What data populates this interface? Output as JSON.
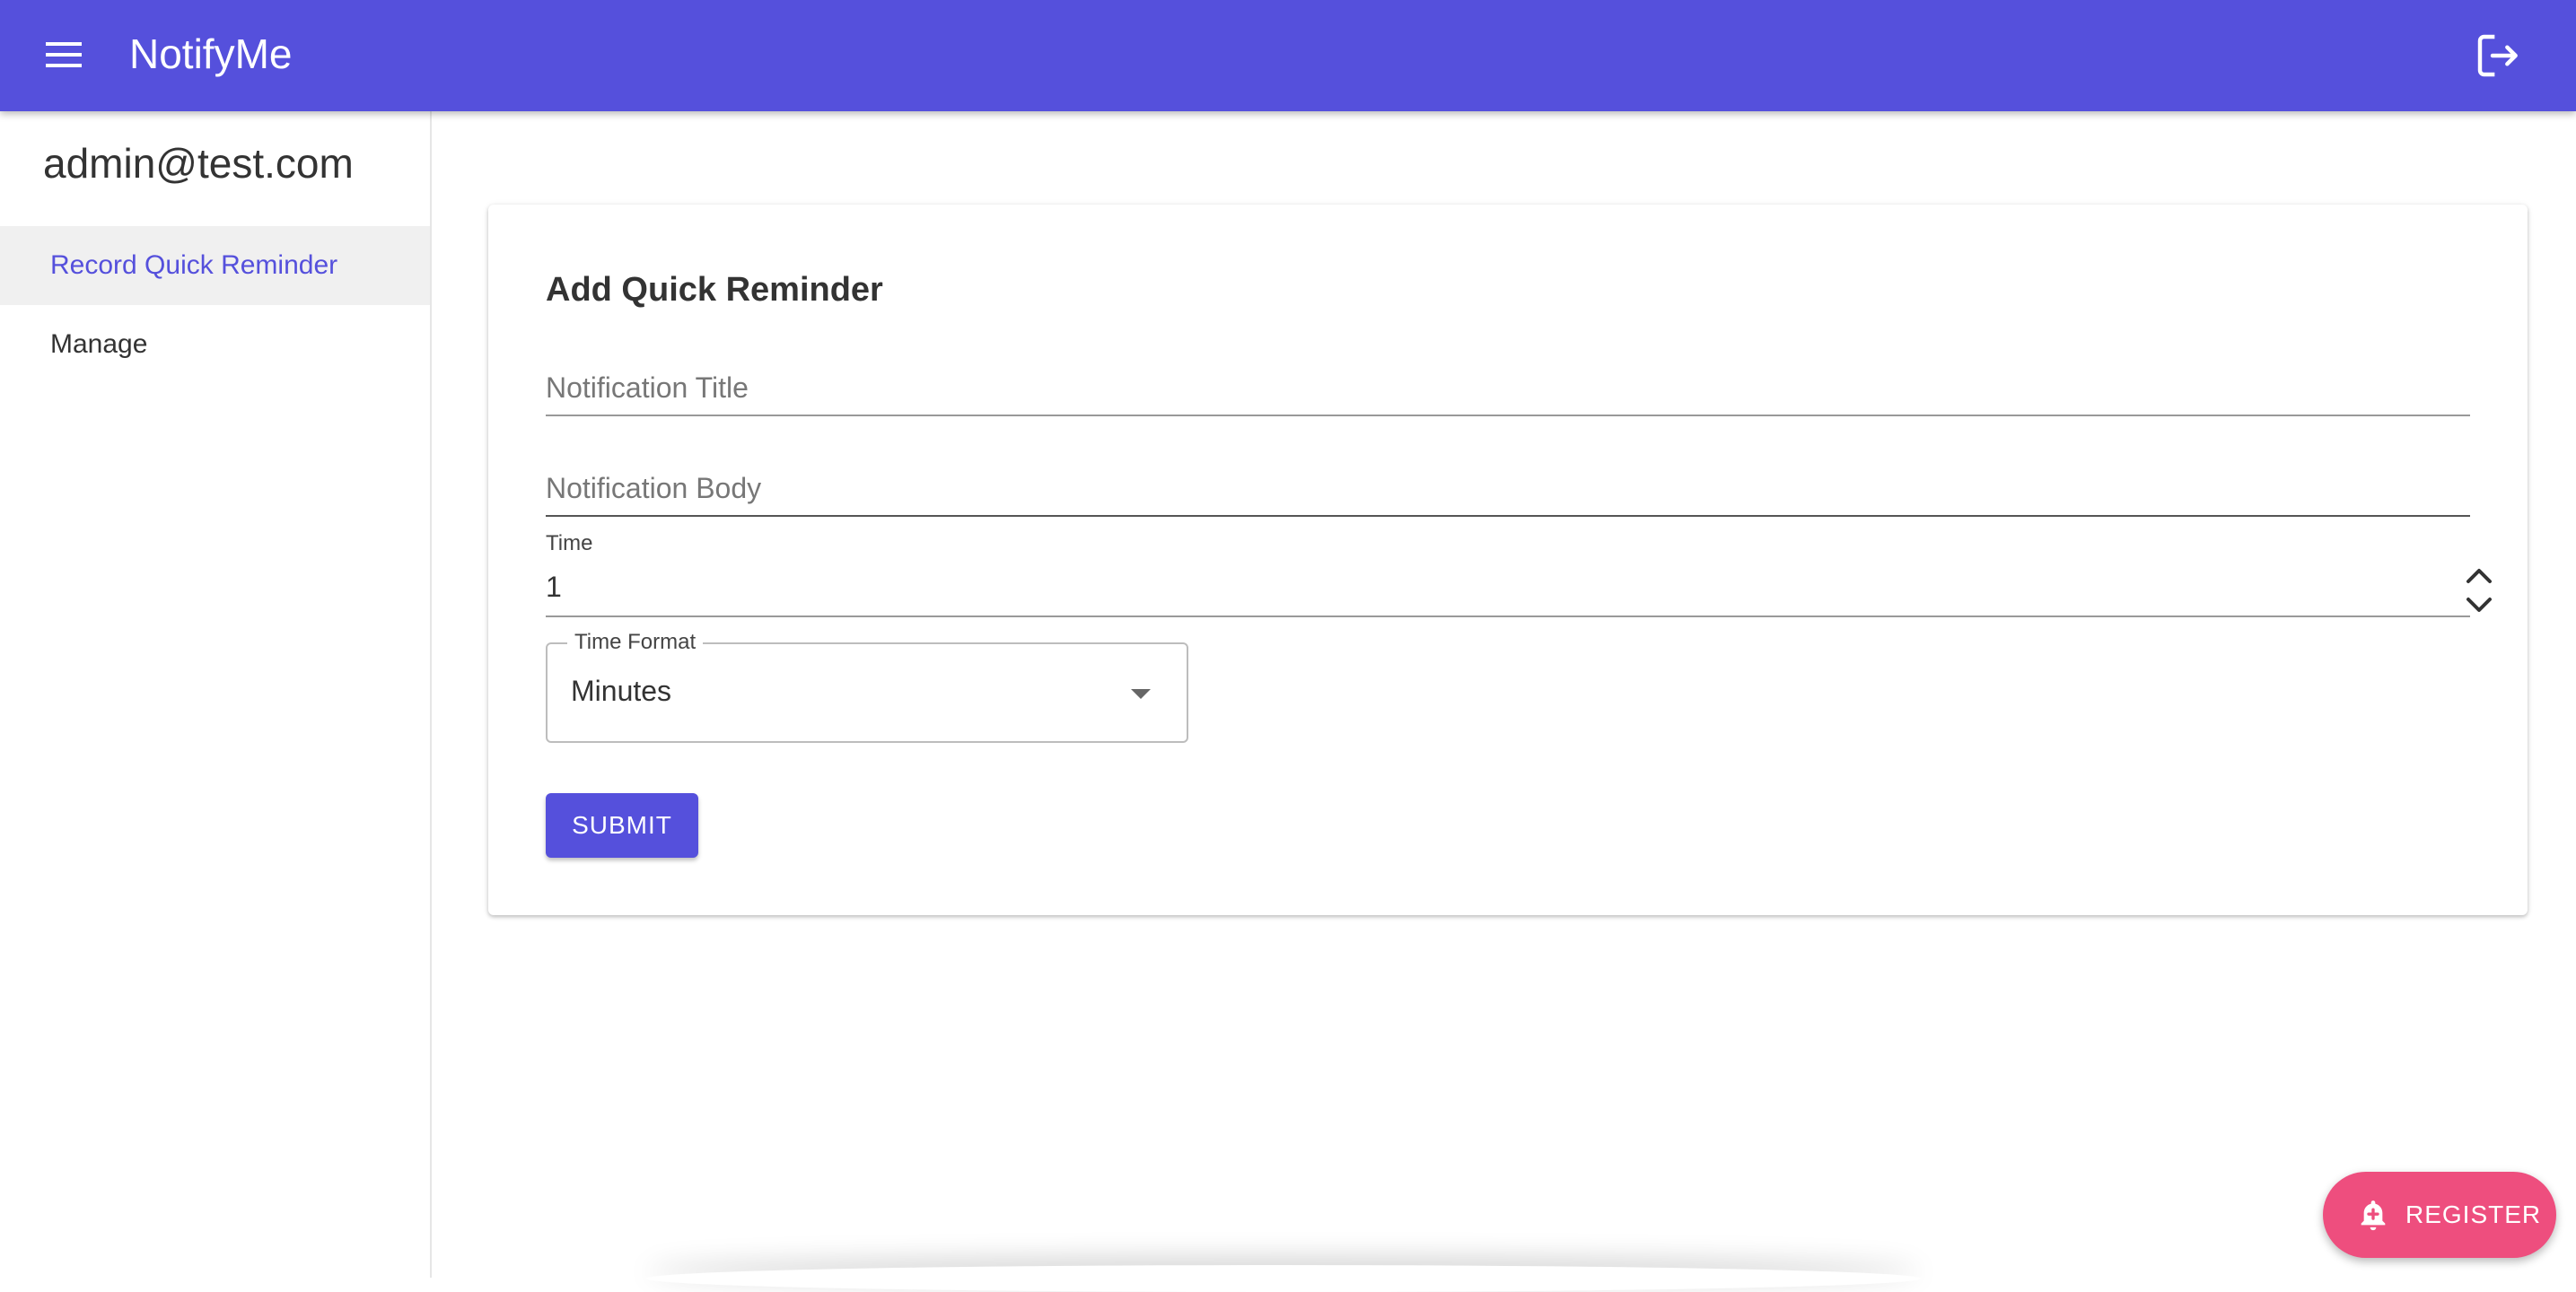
{
  "appbar": {
    "title": "NotifyMe",
    "menu_icon": "menu-icon",
    "logout_icon": "logout-icon",
    "color": "#5550dc"
  },
  "sidebar": {
    "user_email": "admin@test.com",
    "items": [
      {
        "label": "Record Quick Reminder",
        "active": true
      },
      {
        "label": "Manage",
        "active": false
      }
    ]
  },
  "form": {
    "title": "Add Quick Reminder",
    "notification_title_placeholder": "Notification Title",
    "notification_title_value": "",
    "notification_body_placeholder": "Notification Body",
    "notification_body_value": "",
    "time_label": "Time",
    "time_value": "1",
    "time_format_label": "Time Format",
    "time_format_value": "Minutes",
    "submit_label": "SUBMIT"
  },
  "fab": {
    "label": "REGISTER",
    "icon": "add-alert-icon",
    "color": "#ee4e7e"
  }
}
